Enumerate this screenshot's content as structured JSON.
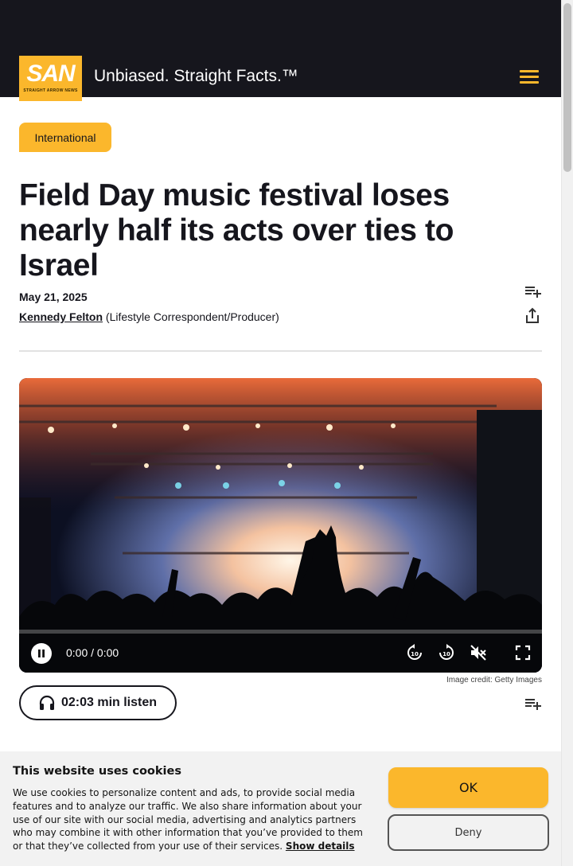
{
  "header": {
    "logo_text": "SAN",
    "logo_subtext": "STRAIGHT ARROW NEWS",
    "tagline": "Unbiased. Straight Facts.™",
    "menu_icon": "hamburger-menu-icon"
  },
  "article": {
    "category": "International",
    "headline": "Field Day music festival loses nearly half its acts over ties to Israel",
    "date": "May 21, 2025",
    "author": "Kennedy Felton",
    "author_role": "(Lifestyle Correspondent/Producer)",
    "actions": {
      "add_to_playlist_icon": "playlist-add-icon",
      "share_icon": "share-icon"
    }
  },
  "media": {
    "time_display": "0:00 / 0:00",
    "progress": 0,
    "state": "playing",
    "muted": true,
    "icons": [
      "pause-icon",
      "rewind-10-icon",
      "forward-10-icon",
      "volume-muted-icon",
      "fullscreen-icon"
    ],
    "credit": "Image credit: Getty Images"
  },
  "listen": {
    "label": "02:03 min listen",
    "icon": "headphones-icon"
  },
  "cookie_banner": {
    "title": "This website uses cookies",
    "body": "We use cookies to personalize content and ads, to provide social media features and to analyze our traffic. We also share information about your use of our site with our social media, advertising and analytics partners who may combine it with other information that you’ve provided to them or that they’ve collected from your use of their services.",
    "show_details": "Show details",
    "ok": "OK",
    "deny": "Deny"
  },
  "colors": {
    "brand_yellow": "#fbb72c",
    "header_bg": "#16161d",
    "banner_bg": "#f2f2f2"
  }
}
